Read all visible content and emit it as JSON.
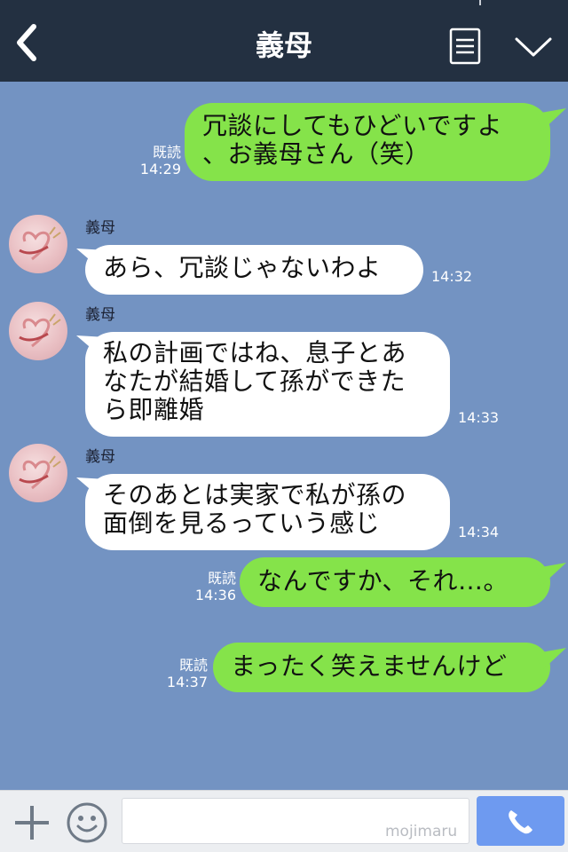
{
  "header": {
    "title": "義母",
    "icons": {
      "back": "chevron-left-icon",
      "notes": "notes-icon",
      "menu": "chevron-down-icon"
    }
  },
  "messages": [
    {
      "direction": "out",
      "lines": [
        "冗談にしてもひどいですよ",
        "、お義母さん（笑）"
      ],
      "read": "既読",
      "time": "14:29"
    },
    {
      "direction": "in",
      "sender": "義母",
      "lines": [
        "あら、冗談じゃないわよ"
      ],
      "time": "14:32"
    },
    {
      "direction": "in",
      "sender": "義母",
      "lines": [
        "私の計画ではね、息子とあ",
        "なたが結婚して孫ができた",
        "ら即離婚"
      ],
      "time": "14:33"
    },
    {
      "direction": "in",
      "sender": "義母",
      "lines": [
        "そのあとは実家で私が孫の",
        "面倒を見るっていう感じ"
      ],
      "time": "14:34"
    },
    {
      "direction": "out",
      "lines": [
        "なんですか、それ…。"
      ],
      "read": "既読",
      "time": "14:36"
    },
    {
      "direction": "out",
      "lines": [
        "まったく笑えませんけど"
      ],
      "read": "既読",
      "time": "14:37"
    }
  ],
  "input_bar": {
    "placeholder": "",
    "watermark": "mojimaru",
    "icons": {
      "add": "plus-icon",
      "emoji": "smiley-icon",
      "call": "phone-icon"
    }
  },
  "colors": {
    "header": "#233041",
    "background": "#7393c2",
    "outgoing_bubble": "#85e34a",
    "incoming_bubble": "#ffffff",
    "call_button": "#6e9af0"
  }
}
